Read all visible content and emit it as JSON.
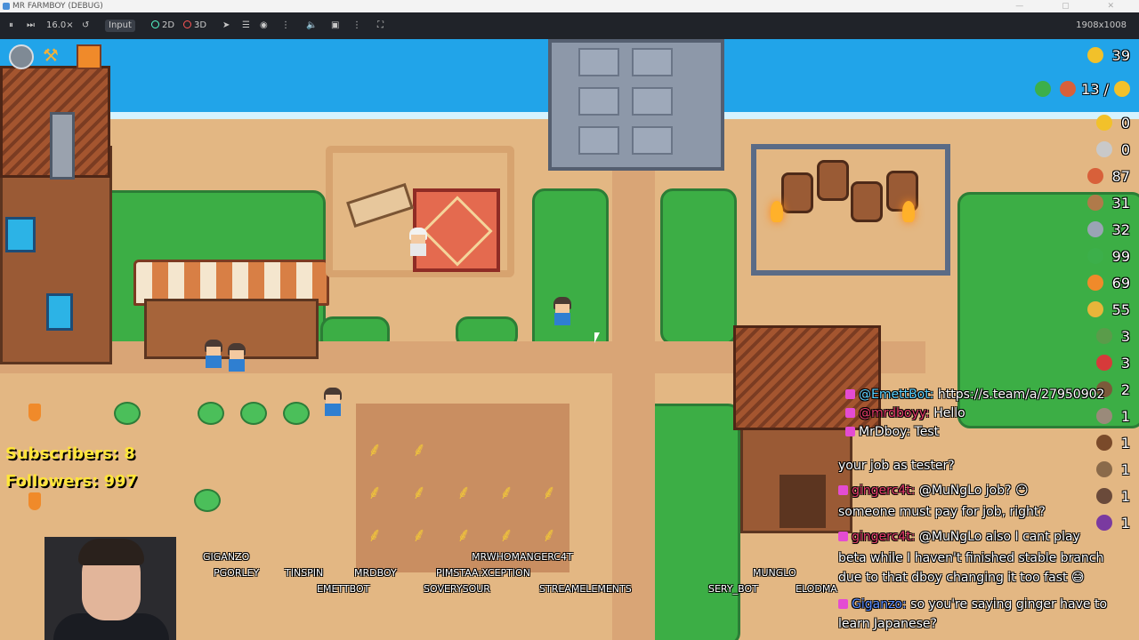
{
  "window": {
    "title": "MR FARMBOY (DEBUG)"
  },
  "debug_toolbar": {
    "zoom_label": "16.0×",
    "input_label": "Input",
    "mode_2d_label": "2D",
    "mode_3d_label": "3D",
    "resolution_label": "1908x1008"
  },
  "hud": {
    "energy_value": "39",
    "counter_label": "13 /",
    "resources": [
      {
        "icon": "gold-coin-icon",
        "value": "0",
        "color": "#f2c12a"
      },
      {
        "icon": "silver-coin-icon",
        "value": "0",
        "color": "#c9c9c9"
      },
      {
        "icon": "meat-icon",
        "value": "87",
        "color": "#d8603a"
      },
      {
        "icon": "wood-icon",
        "value": "31",
        "color": "#b07a4a"
      },
      {
        "icon": "stone-icon",
        "value": "32",
        "color": "#9aa4b4"
      },
      {
        "icon": "plant-icon",
        "value": "99",
        "color": "#3caf4a"
      },
      {
        "icon": "carrot-icon",
        "value": "69",
        "color": "#f08a2a"
      },
      {
        "icon": "wheat-icon",
        "value": "55",
        "color": "#e9b53a"
      },
      {
        "icon": "tool-icon",
        "value": "3",
        "color": "#5a9c4a"
      },
      {
        "icon": "berry-icon",
        "value": "3",
        "color": "#d63a3a"
      },
      {
        "icon": "item-icon",
        "value": "2",
        "color": "#7b5a3a"
      },
      {
        "icon": "item-icon",
        "value": "1",
        "color": "#9a8a7a"
      },
      {
        "icon": "item-icon",
        "value": "1",
        "color": "#7a4a2a"
      },
      {
        "icon": "item-icon",
        "value": "1",
        "color": "#8a6a4a"
      },
      {
        "icon": "item-icon",
        "value": "1",
        "color": "#6a4a3a"
      },
      {
        "icon": "item-icon",
        "value": "1",
        "color": "#7a3aa0"
      }
    ]
  },
  "stream_stats": {
    "subscribers": "Subscribers: 8",
    "followers": "Followers: 997"
  },
  "chat": [
    {
      "user": "@EmettBot:",
      "text": "https://s.team/a/27950902",
      "user_color": "#5ad0ff"
    },
    {
      "user": "@mrdboyy:",
      "text": "Hello",
      "user_color": "#e23a6a"
    },
    {
      "user": "MrDboy:",
      "text": "Test",
      "user_color": "#ffffff"
    },
    {
      "user": "",
      "text": "your job as tester?",
      "user_color": "#ffffff"
    },
    {
      "user": "gingerc4t:",
      "text": "@MuNgLo job? 😶",
      "user_color": "#e23a6a"
    },
    {
      "user": "",
      "text": "someone must pay for job, right?",
      "user_color": "#ffffff"
    },
    {
      "user": "gingerc4t:",
      "text": "@MuNgLo also I cant play",
      "user_color": "#e23a6a"
    },
    {
      "user": "",
      "text": "beta while I haven't finished stable branch",
      "user_color": "#ffffff"
    },
    {
      "user": "",
      "text": "due to that dboy changing it too fast 😅",
      "user_color": "#ffffff"
    },
    {
      "user": "Giganzo:",
      "text": "so you're saying ginger have to",
      "user_color": "#5a8dff"
    },
    {
      "user": "",
      "text": "learn Japanese?",
      "user_color": "#ffffff"
    }
  ],
  "viewer_names": [
    "GIGANZO",
    "PGORLEY",
    "TINSPIN",
    "EMETTBOT",
    "MRDBOY",
    "MRWHOMANGERC4T",
    "PIMSTAA:XCEPTION",
    "SOVERYSOUR",
    "STREAMELEMENTS",
    "SERY_BOT",
    "MUNGLO",
    "ELODMA"
  ]
}
